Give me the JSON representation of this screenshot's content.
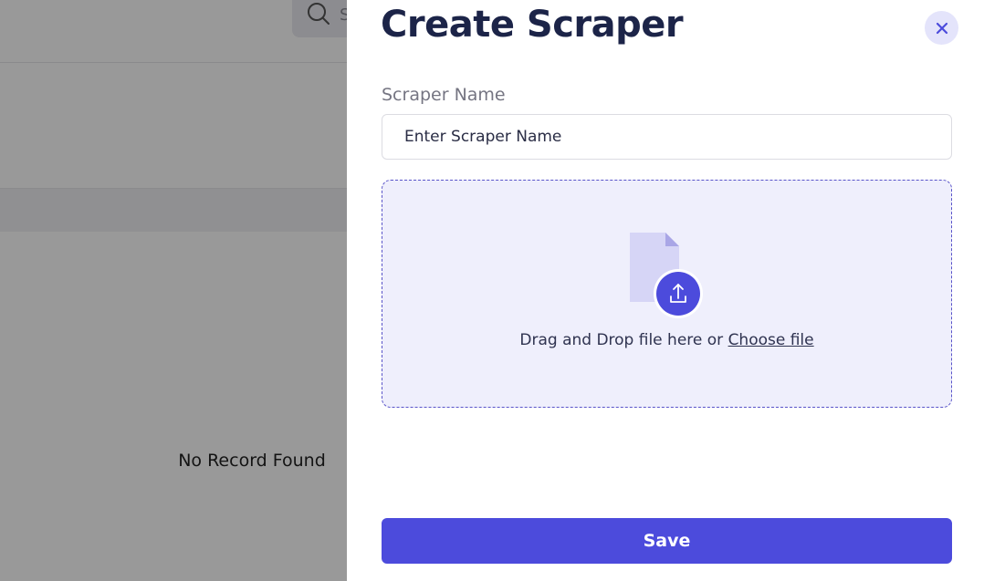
{
  "background": {
    "search_placeholder": "S",
    "empty_state": "No Record Found"
  },
  "drawer": {
    "title": "Create Scraper",
    "close_icon": "close-icon",
    "name_label": "Scraper Name",
    "name_placeholder": "Enter Scraper Name",
    "name_value": "",
    "dropzone": {
      "text": "Drag and Drop file here or",
      "link": "Choose file",
      "icon": "file-upload-icon"
    },
    "save_label": "Save"
  },
  "colors": {
    "accent": "#4c4bdc",
    "title": "#1c2448",
    "dropzone_bg": "#efeffc",
    "close_bg": "#e4e4fb"
  }
}
